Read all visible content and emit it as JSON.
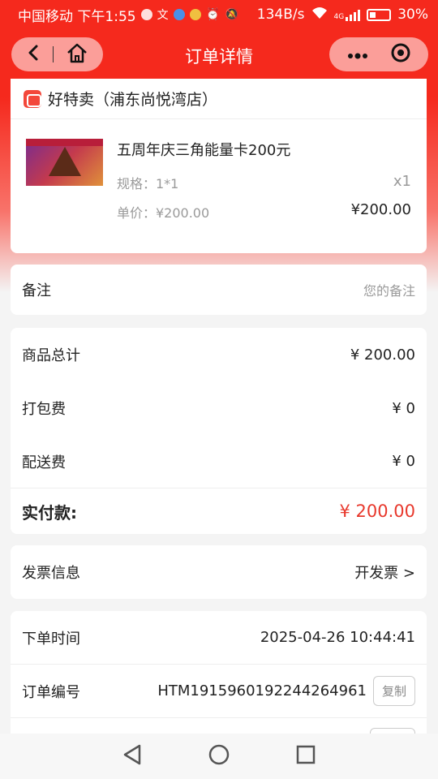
{
  "status_bar": {
    "carrier": "中国移动 下午1:55",
    "speed": "134B/s",
    "network": "4G",
    "battery": "30%"
  },
  "nav": {
    "title": "订单详情"
  },
  "shop": {
    "name": "好特卖（浦东尚悦湾店）"
  },
  "product": {
    "name": "五周年庆三角能量卡200元",
    "spec": "规格：1*1",
    "qty": "x1",
    "unit_price": "单价：¥200.00",
    "subtotal": "¥200.00"
  },
  "remark": {
    "label": "备注",
    "placeholder": "您的备注"
  },
  "summary": {
    "goods_total_label": "商品总计",
    "goods_total": "¥ 200.00",
    "packing_label": "打包费",
    "packing": "¥ 0",
    "delivery_label": "配送费",
    "delivery": "¥ 0",
    "paid_label": "实付款:",
    "paid": "¥ 200.00"
  },
  "invoice": {
    "label": "发票信息",
    "action": "开发票 >"
  },
  "order_info": {
    "time_label": "下单时间",
    "time": "2025-04-26 10:44:41",
    "number_label": "订单编号",
    "number": "HTM1915960192244264961",
    "copy_label": "复制"
  },
  "colors": {
    "brand_red": "#f5291d",
    "price_red": "#e8382c"
  }
}
